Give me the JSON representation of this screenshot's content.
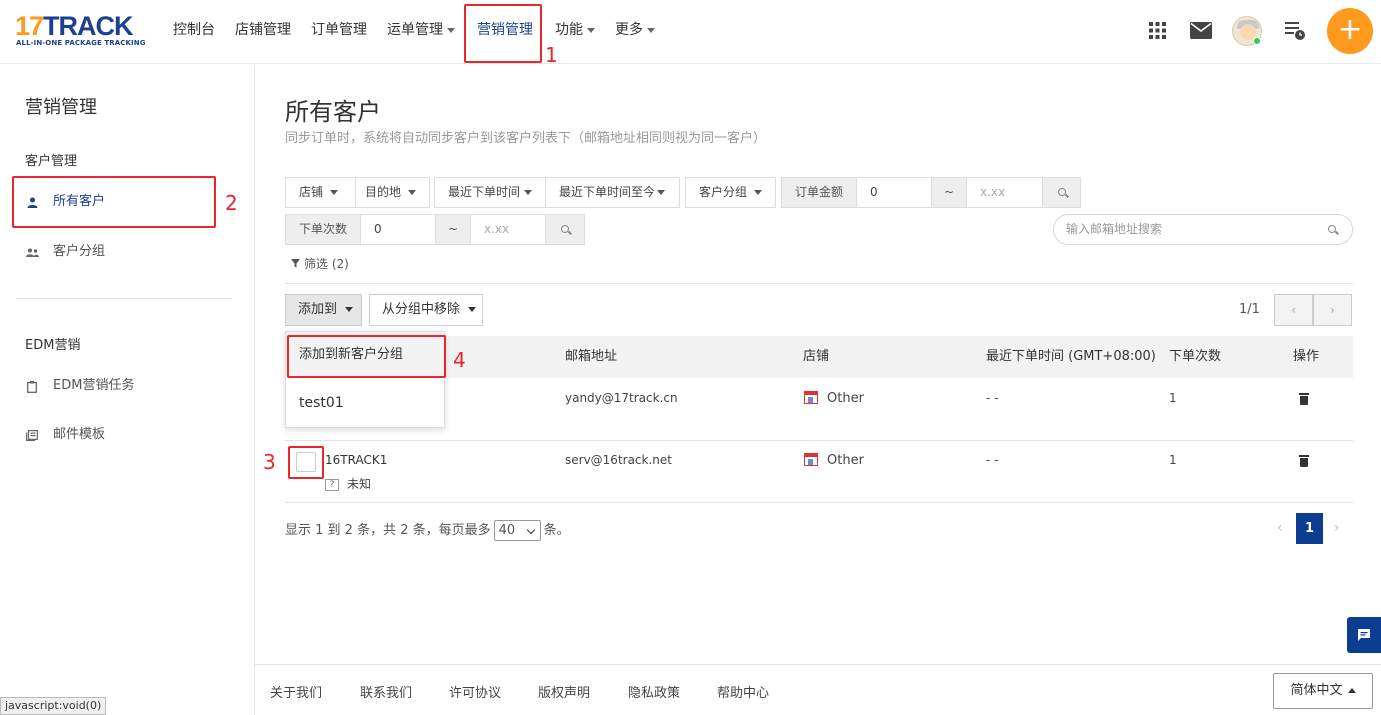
{
  "logo": {
    "main_left": "17",
    "main_right": "TRACK",
    "sub": "ALL-IN-ONE PACKAGE TRACKING"
  },
  "nav": [
    {
      "label": "控制台",
      "caret": false
    },
    {
      "label": "店铺管理",
      "caret": false
    },
    {
      "label": "订单管理",
      "caret": false
    },
    {
      "label": "运单管理",
      "caret": true
    },
    {
      "label": "营销管理",
      "caret": false
    },
    {
      "label": "功能",
      "caret": true
    },
    {
      "label": "更多",
      "caret": true
    }
  ],
  "annotations": {
    "a1": "1",
    "a2": "2",
    "a3": "3",
    "a4": "4"
  },
  "toolbar": {
    "add_label": "+",
    "icons": [
      "apps-grid-icon",
      "mail-icon",
      "avatar",
      "task-list-icon"
    ]
  },
  "sidebar": {
    "title": "营销管理",
    "group1": "客户管理",
    "item_all": "所有客户",
    "item_group": "客户分组",
    "group2": "EDM营销",
    "item_edm": "EDM营销任务",
    "item_tpl": "邮件模板"
  },
  "main": {
    "title": "所有客户",
    "subtitle": "同步订单时，系统将自动同步客户到该客户列表下（邮箱地址相同则视为同一客户）"
  },
  "filters": {
    "shop": "店铺",
    "dest": "目的地",
    "last_order": "最近下单时间",
    "last_order_to_now": "最近下单时间至今",
    "customer_group": "客户分组",
    "amount_label": "订单金额",
    "amount_min": "0",
    "range_sep": "~",
    "amount_max_ph": "x.xx",
    "count_label": "下单次数",
    "count_min": "0",
    "count_max_ph": "x.xx",
    "email_search_ph": "输入邮箱地址搜索",
    "filter_tag": "筛选 (2)"
  },
  "actions": {
    "add_to": "添加到",
    "remove_from_group": "从分组中移除",
    "page_count": "1/1",
    "prev": "‹",
    "next": "›"
  },
  "dropdown": {
    "new_group": "添加到新客户分组",
    "group1": "test01"
  },
  "table": {
    "headers": {
      "email": "邮箱地址",
      "shop": "店铺",
      "last_order_time": "最近下单时间 (GMT+08:00)",
      "order_count": "下单次数",
      "ops": "操作"
    },
    "rows": [
      {
        "name": "",
        "email": "yandy@17track.cn",
        "shop": "Other",
        "last": "- -",
        "count": "1"
      },
      {
        "name": "16TRACK1",
        "country_icon": "?",
        "country": "未知",
        "email": "serv@16track.net",
        "shop": "Other",
        "last": "- -",
        "count": "1"
      }
    ]
  },
  "pagination": {
    "showing_prefix": "显示 1 到 2 条，共 2 条，每页最多",
    "per_page": "40",
    "showing_suffix": "条。",
    "current": "1",
    "prev": "‹",
    "next": "›"
  },
  "footer": {
    "links": [
      "关于我们",
      "联系我们",
      "许可协议",
      "版权声明",
      "隐私政策",
      "帮助中心"
    ],
    "lang": "简体中文"
  },
  "status_bar": "javascript:void(0)"
}
